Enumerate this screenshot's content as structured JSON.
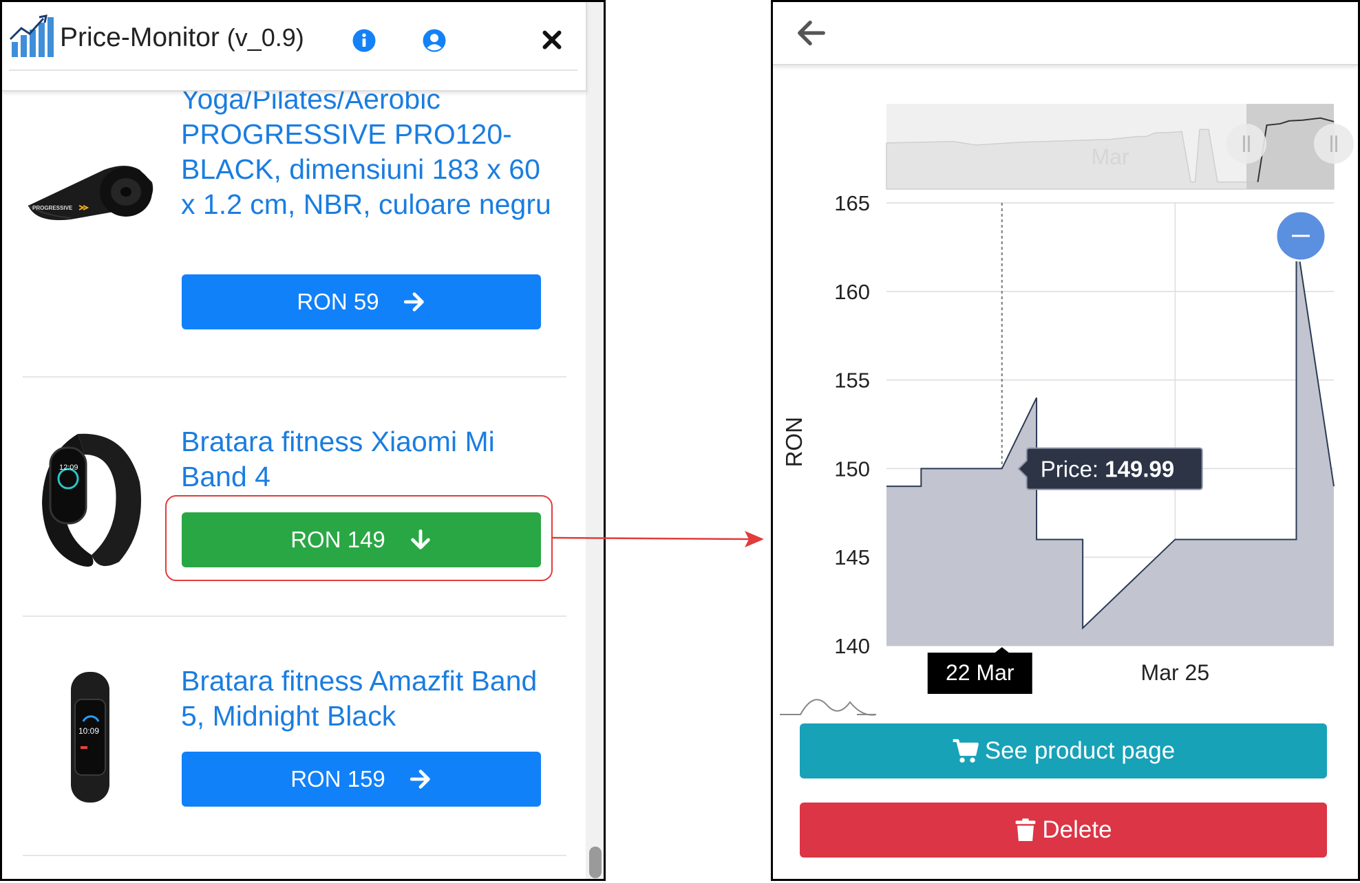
{
  "left_popup": {
    "app_title": "Price-Monitor",
    "app_version": "(v_0.9)",
    "icons": {
      "logo": "bar-chart-logo-icon",
      "info": "info-circle-icon",
      "user": "user-circle-icon",
      "close": "close-icon"
    },
    "products": [
      {
        "title": "Yoga/Pilates/Aerobic PROGRESSIVE PRO120-BLACK, dimensiuni 183 x 60 x 1.2 cm, NBR, culoare negru",
        "image_brand_text": "PROGRESSIVE",
        "price_label": "RON 59",
        "trend_icon": "arrow-right-icon",
        "button_color": "#1181f9"
      },
      {
        "title": "Bratara fitness Xiaomi Mi Band 4",
        "price_label": "RON 149",
        "trend_icon": "arrow-down-icon",
        "button_color": "#2aa745"
      },
      {
        "title": "Bratara fitness Amazfit Band 5, Midnight Black",
        "price_label": "RON 159",
        "trend_icon": "arrow-right-icon",
        "button_color": "#1181f9"
      }
    ]
  },
  "right_popup": {
    "back_icon": "arrow-left-icon",
    "tooltip": {
      "label": "Price:",
      "value": "149.99"
    },
    "crosshair_label": "22 Mar",
    "navigator_label": "Mar",
    "actions": {
      "see_product": {
        "label": "See product page",
        "icon": "shopping-cart-icon",
        "color": "#17a2b8"
      },
      "delete": {
        "label": "Delete",
        "icon": "trash-icon",
        "color": "#dc3545"
      }
    }
  },
  "chart_data": {
    "type": "area",
    "ylabel": "RON",
    "ylim": [
      140,
      165
    ],
    "yticks": [
      140,
      145,
      150,
      155,
      160,
      165
    ],
    "xticks": [
      {
        "value": 25,
        "label": "Mar 25"
      }
    ],
    "x_unit": "day of March",
    "series": [
      {
        "points": [
          [
            20.0,
            149
          ],
          [
            20.6,
            149
          ],
          [
            20.6,
            150
          ],
          [
            22.0,
            150
          ],
          [
            22.6,
            154
          ],
          [
            22.6,
            146
          ],
          [
            23.4,
            146
          ],
          [
            23.4,
            141
          ],
          [
            25.0,
            146
          ],
          [
            27.1,
            146
          ],
          [
            27.1,
            163
          ],
          [
            27.75,
            149
          ]
        ]
      }
    ],
    "selected_point": {
      "x": 22.0,
      "y": 149.99
    },
    "series_color": "#c2c5cf",
    "line_color": "#2b3a56",
    "reset_zoom_icon": "minus-circle-icon",
    "grid": true
  }
}
